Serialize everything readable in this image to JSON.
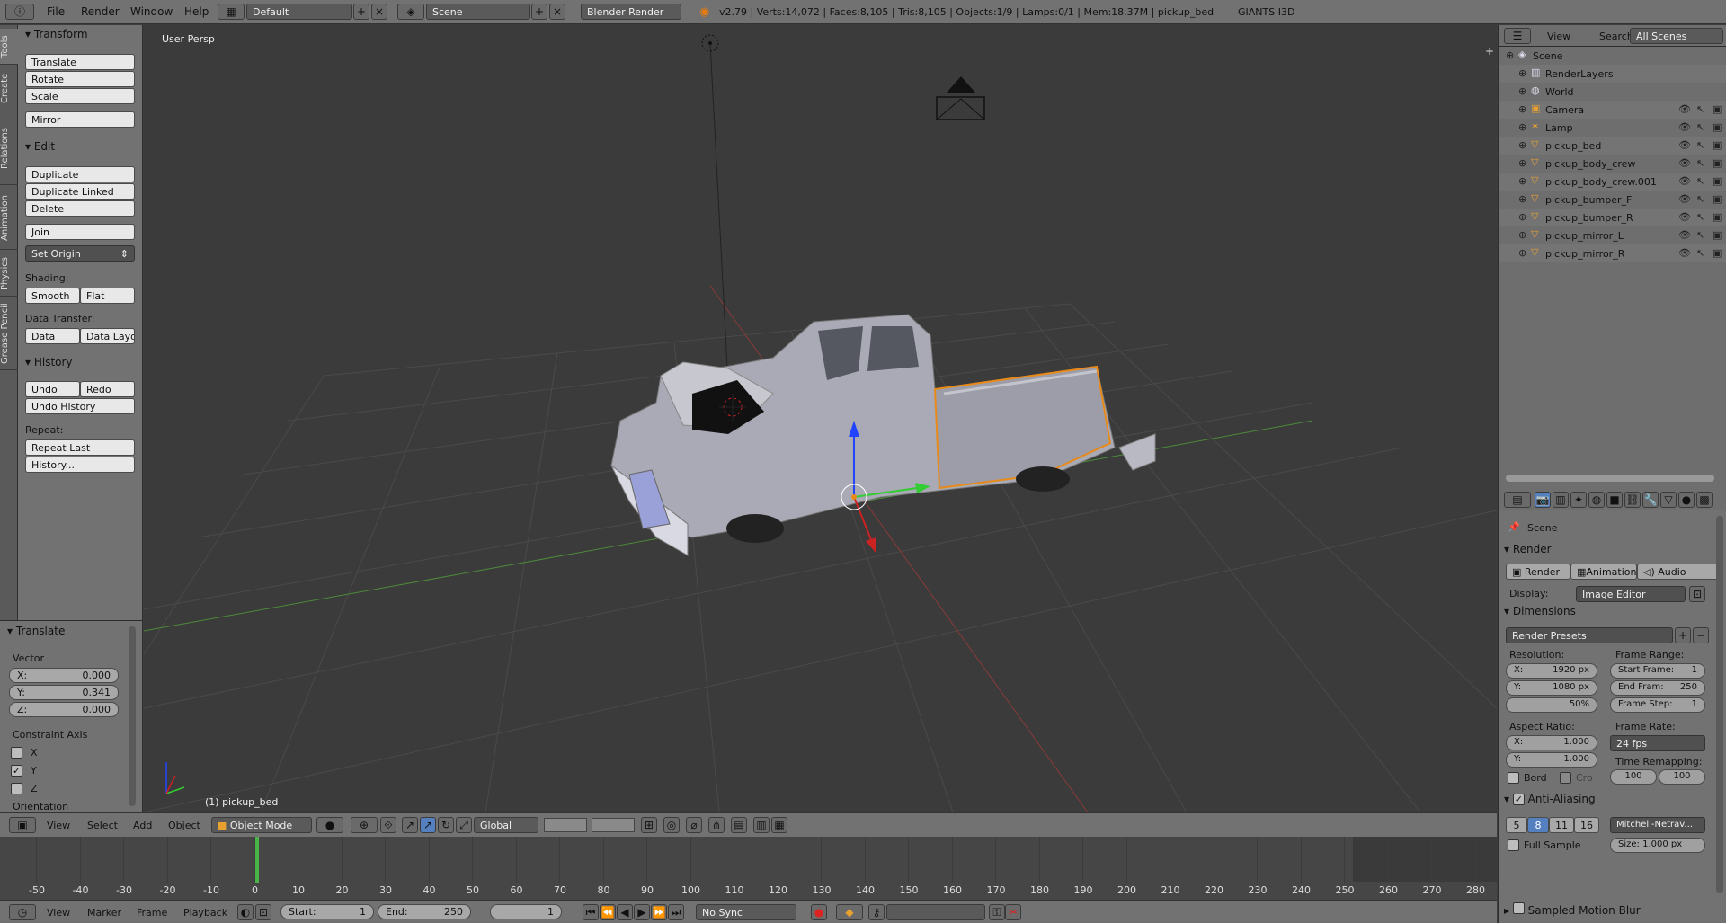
{
  "topbar": {
    "menu": [
      "File",
      "Render",
      "Window",
      "Help"
    ],
    "layout": "Default",
    "scene": "Scene",
    "engine": "Blender Render",
    "stats": "v2.79 | Verts:14,072 | Faces:8,105 | Tris:8,105 | Objects:1/9 | Lamps:0/1 | Mem:18.37M | pickup_bed",
    "extra": "GIANTS I3D"
  },
  "tabs": [
    "Tools",
    "Create",
    "Relations",
    "Animation",
    "Physics",
    "Grease Pencil"
  ],
  "tools": {
    "transform_title": "Transform",
    "translate": "Translate",
    "rotate": "Rotate",
    "scale": "Scale",
    "mirror": "Mirror",
    "edit_title": "Edit",
    "duplicate": "Duplicate",
    "duplicate_linked": "Duplicate Linked",
    "delete": "Delete",
    "join": "Join",
    "set_origin": "Set Origin",
    "shading_label": "Shading:",
    "smooth": "Smooth",
    "flat": "Flat",
    "data_transfer_label": "Data Transfer:",
    "data": "Data",
    "data_layout": "Data Layo",
    "history_title": "History",
    "undo": "Undo",
    "redo": "Redo",
    "undo_history": "Undo History",
    "repeat_label": "Repeat:",
    "repeat_last": "Repeat Last",
    "history_dots": "History..."
  },
  "operator": {
    "title": "Translate",
    "vector_label": "Vector",
    "x": "X:",
    "x_val": "0.000",
    "y": "Y:",
    "y_val": "0.341",
    "z": "Z:",
    "z_val": "0.000",
    "constraint_label": "Constraint Axis",
    "cx": "X",
    "cy": "Y",
    "cz": "Z",
    "orientation": "Orientation"
  },
  "viewport": {
    "label": "User Persp",
    "object": "(1) pickup_bed"
  },
  "viewheader": {
    "view": "View",
    "select": "Select",
    "add": "Add",
    "object": "Object",
    "mode": "Object Mode",
    "orientation": "Global"
  },
  "timeline": {
    "ticks": [
      "-50",
      "-40",
      "-30",
      "-20",
      "-10",
      "0",
      "10",
      "20",
      "30",
      "40",
      "50",
      "60",
      "70",
      "80",
      "90",
      "100",
      "110",
      "120",
      "130",
      "140",
      "150",
      "160",
      "170",
      "180",
      "190",
      "200",
      "210",
      "220",
      "230",
      "240",
      "250",
      "260",
      "270",
      "280"
    ],
    "current_frame": 1
  },
  "tlbar": {
    "view": "View",
    "marker": "Marker",
    "frame": "Frame",
    "playback": "Playback",
    "start_label": "Start:",
    "start": "1",
    "end_label": "End:",
    "end": "250",
    "current": "1",
    "sync": "No Sync"
  },
  "outliner": {
    "view": "View",
    "search": "Search",
    "filter": "All Scenes",
    "items": [
      {
        "name": "Scene",
        "indent": 0
      },
      {
        "name": "RenderLayers",
        "indent": 1
      },
      {
        "name": "World",
        "indent": 1
      },
      {
        "name": "Camera",
        "indent": 1
      },
      {
        "name": "Lamp",
        "indent": 1
      },
      {
        "name": "pickup_bed",
        "indent": 1
      },
      {
        "name": "pickup_body_crew",
        "indent": 1
      },
      {
        "name": "pickup_body_crew.001",
        "indent": 1
      },
      {
        "name": "pickup_bumper_F",
        "indent": 1
      },
      {
        "name": "pickup_bumper_R",
        "indent": 1
      },
      {
        "name": "pickup_mirror_L",
        "indent": 1
      },
      {
        "name": "pickup_mirror_R",
        "indent": 1
      }
    ]
  },
  "props": {
    "scene": "Scene",
    "render_title": "Render",
    "render_btn": "Render",
    "animation_btn": "Animation",
    "audio_btn": "Audio",
    "display_label": "Display:",
    "display": "Image Editor",
    "dimensions_title": "Dimensions",
    "presets": "Render Presets",
    "resolution_label": "Resolution:",
    "res_x": "X:",
    "res_x_val": "1920 px",
    "res_y": "Y:",
    "res_y_val": "1080 px",
    "res_pct": "50%",
    "frame_range_label": "Frame Range:",
    "start_frame": "Start Frame:",
    "start_frame_val": "1",
    "end_frame": "End Fram:",
    "end_frame_val": "250",
    "frame_step": "Frame Step:",
    "frame_step_val": "1",
    "aspect_label": "Aspect Ratio:",
    "asp_x": "X:",
    "asp_x_val": "1.000",
    "asp_y": "Y:",
    "asp_y_val": "1.000",
    "frame_rate_label": "Frame Rate:",
    "fps": "24 fps",
    "time_remap_label": "Time Remapping:",
    "remap_a": "100",
    "remap_b": "100",
    "bord": "Bord",
    "cro": "Cro",
    "aa_title": "Anti-Aliasing",
    "aa_5": "5",
    "aa_8": "8",
    "aa_11": "11",
    "aa_16": "16",
    "filter": "Mitchell-Netrav...",
    "full_sample": "Full Sample",
    "size": "Size: 1.000 px",
    "smb_title": "Sampled Motion Blur"
  }
}
